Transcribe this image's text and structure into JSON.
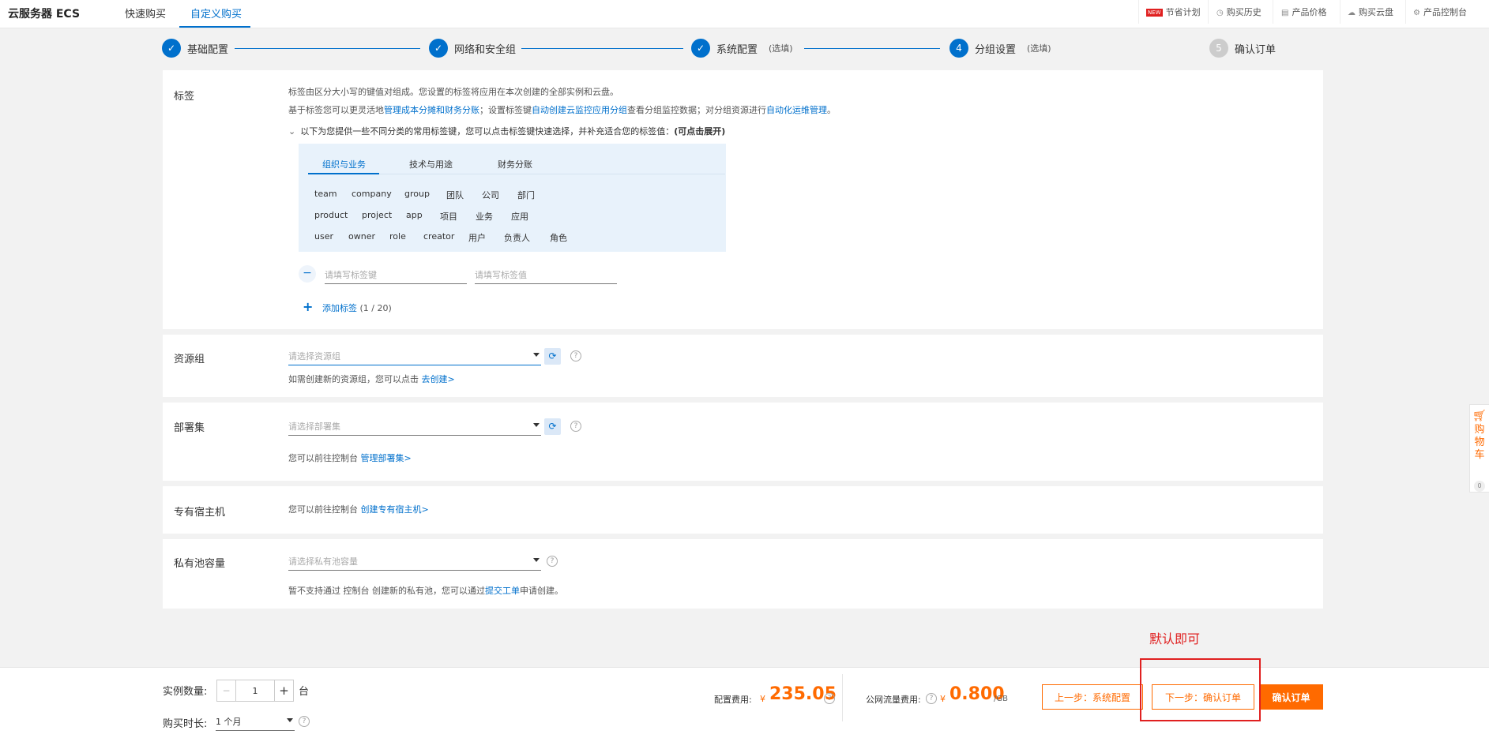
{
  "topbar": {
    "brand": "云服务器 ECS",
    "tabs": [
      "快速购买",
      "自定义购买"
    ],
    "links": {
      "new_badge": "NEW",
      "saving": "节省计划",
      "history": "购买历史",
      "price": "产品价格",
      "disk": "购买云盘",
      "console": "产品控制台"
    }
  },
  "steps": {
    "s1": "基础配置",
    "s2": "网络和安全组",
    "s3": "系统配置",
    "s3_opt": "(选填)",
    "s4_num": "4",
    "s4": "分组设置",
    "s4_opt": "(选填)",
    "s5_num": "5",
    "s5": "确认订单"
  },
  "tags": {
    "label": "标签",
    "desc1": "标签由区分大小写的键值对组成。您设置的标签将应用在本次创建的全部实例和云盘。",
    "desc2_a": "基于标签您可以更灵活地",
    "desc2_link1": "管理成本分摊和财务分账",
    "desc2_b": "；设置标签键",
    "desc2_link2": "自动创建云监控应用分组",
    "desc2_c": "查看分组监控数据；对分组资源进行",
    "desc2_link3": "自动化运维管理",
    "desc2_d": "。",
    "expand_text": "以下为您提供一些不同分类的常用标签键，您可以点击标签键快速选择，并补充适合您的标签值：",
    "expand_bold": "(可点击展开)",
    "tabs": [
      "组织与业务",
      "技术与用途",
      "财务分账"
    ],
    "row1": [
      "team",
      "company",
      "group",
      "团队",
      "公司",
      "部门"
    ],
    "row2": [
      "product",
      "project",
      "app",
      "项目",
      "业务",
      "应用"
    ],
    "row3": [
      "user",
      "owner",
      "role",
      "creator",
      "用户",
      "负责人",
      "角色"
    ],
    "key_placeholder": "请填写标签键",
    "value_placeholder": "请填写标签值",
    "add_label": "添加标签",
    "add_count": "(1 / 20)"
  },
  "resource_group": {
    "label": "资源组",
    "placeholder": "请选择资源组",
    "hint": "如需创建新的资源组，您可以点击",
    "hint_link": "去创建>"
  },
  "deploy_set": {
    "label": "部署集",
    "placeholder": "请选择部署集",
    "hint": "您可以前往控制台",
    "hint_link": "管理部署集>"
  },
  "dedicated_host": {
    "label": "专有宿主机",
    "hint": "您可以前往控制台",
    "hint_link": "创建专有宿主机>"
  },
  "private_pool": {
    "label": "私有池容量",
    "placeholder": "请选择私有池容量",
    "hint_a": "暂不支持通过 控制台 创建新的私有池，您可以通过",
    "hint_link": "提交工单",
    "hint_b": "申请创建。"
  },
  "bottom": {
    "qty_label": "实例数量:",
    "qty_value": "1",
    "qty_unit": "台",
    "duration_label": "购买时长:",
    "duration_value": "1 个月",
    "config_fee_label": "配置费用:",
    "config_fee": "235.05",
    "traffic_fee_label": "公网流量费用:",
    "traffic_fee": "0.800",
    "traffic_unit": "/GB",
    "currency": "¥",
    "prev_btn": "上一步：系统配置",
    "next_btn": "下一步：确认订单",
    "confirm_btn": "确认订单"
  },
  "annotation": "默认即可",
  "cart": {
    "label": "购物车",
    "count": "0"
  },
  "colors": {
    "accent": "#0070cc",
    "orange": "#ff6a00",
    "annotation_red": "#e02020"
  }
}
